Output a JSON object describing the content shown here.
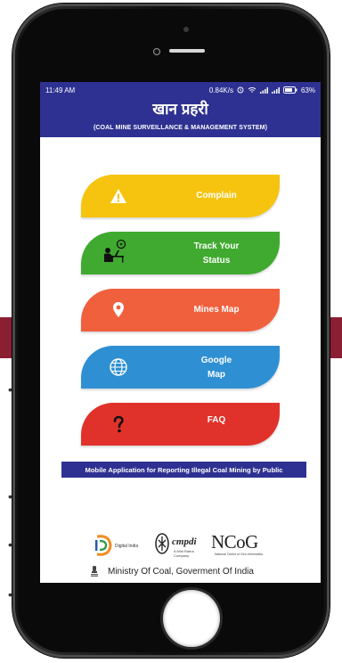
{
  "statusbar": {
    "time": "11:49 AM",
    "network_speed": "0.84K/s",
    "battery": "63%"
  },
  "app": {
    "title": "खान प्रहरी",
    "subtitle": "(COAL MINE SURVEILLANCE & MANAGEMENT SYSTEM)"
  },
  "menu": [
    {
      "label": "Complain",
      "icon": "warning-icon",
      "color": "#f6c40f"
    },
    {
      "label": "Track Your Status",
      "label_line1": "Track Your",
      "label_line2": "Status",
      "icon": "person-at-desk-icon",
      "color": "#3faa2f"
    },
    {
      "label": "Mines Map",
      "icon": "map-pin-icon",
      "color": "#f0603c"
    },
    {
      "label": "Google Map",
      "label_line1": "Google",
      "label_line2": "Map",
      "icon": "globe-icon",
      "color": "#2f8fd3"
    },
    {
      "label": "FAQ",
      "icon": "question-icon",
      "color": "#e0322a"
    }
  ],
  "banner": "Mobile Application for Reporting Illegal Coal Mining by Public",
  "logos": {
    "digital_india": "Digital India",
    "cmpdi": "cmpdi",
    "cmpdi_sub": "A Mini Ratna Company",
    "ncog": "NCoG",
    "ncog_sub": "National Centre of Geo-Informatics"
  },
  "footer": "Ministry Of Coal, Goverment Of India",
  "colors": {
    "primary": "#2e3191",
    "background_band": "#8a1f34"
  }
}
